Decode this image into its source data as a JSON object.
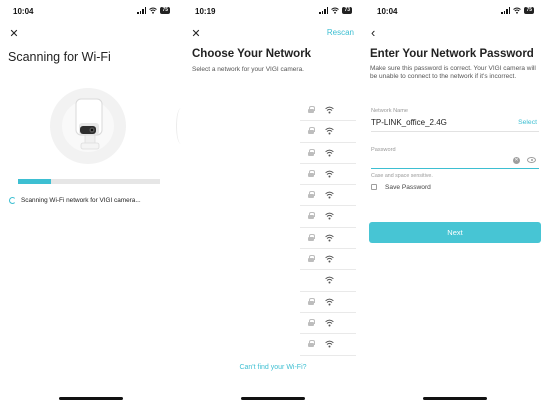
{
  "status_bars": [
    {
      "time": "10:04",
      "battery": "75"
    },
    {
      "time": "10:19",
      "battery": "73"
    },
    {
      "time": "10:04",
      "battery": "75"
    }
  ],
  "screen1": {
    "close_icon": "close-icon",
    "title": "Scanning for Wi-Fi",
    "progress": 0.23,
    "scan_status": "Scanning Wi-Fi network for VIGI camera..."
  },
  "screen2": {
    "back_marker": "‹",
    "title": "Choose Your Network",
    "rescan_label": "Rescan",
    "subtitle": "Select a network for your VIGI camera.",
    "networks": [
      {
        "ssid": "",
        "secured": true
      },
      {
        "ssid": "",
        "secured": true
      },
      {
        "ssid": "",
        "secured": true
      },
      {
        "ssid": "",
        "secured": true
      },
      {
        "ssid": "",
        "secured": true
      },
      {
        "ssid": "",
        "secured": true
      },
      {
        "ssid": "",
        "secured": true
      },
      {
        "ssid": "",
        "secured": true
      },
      {
        "ssid": "",
        "secured": false
      },
      {
        "ssid": "",
        "secured": true
      },
      {
        "ssid": "",
        "secured": true
      },
      {
        "ssid": "",
        "secured": true
      }
    ],
    "cant_find_link": "Can't find your Wi-Fi?"
  },
  "screen3": {
    "title": "Enter Your Network Password",
    "description": "Make sure this password is correct. Your VIGI camera will be unable to connect to the network if it's incorrect.",
    "network_name_label": "Network Name",
    "network_name_value": "TP-LINK_office_2.4G",
    "select_label": "Select",
    "password_label": "Password",
    "password_value": "",
    "password_hint": "Case and space sensitive.",
    "save_password_label": "Save Password",
    "save_password_checked": false,
    "next_button": "Next"
  },
  "colors": {
    "accent": "#3dbfd2",
    "button": "#47c5d4",
    "text": "#222222",
    "muted": "#999999"
  }
}
